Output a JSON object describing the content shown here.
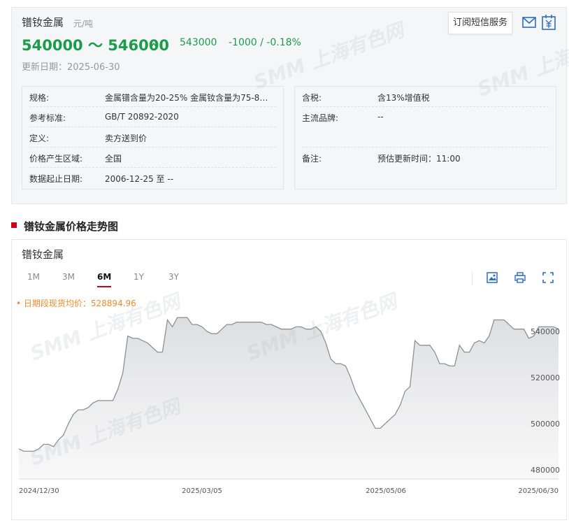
{
  "header": {
    "title": "镨钕金属",
    "unit": "元/吨",
    "price_range": "540000 ～ 546000",
    "avg_price": "543000",
    "change": "-1000  /  -0.18%",
    "updated": "更新日期：2025-06-30",
    "subscribe_label": "订阅短信服务",
    "trend_icon": "down-wave-icon"
  },
  "specs_left": [
    {
      "k": "规格:",
      "v": "金属镨含量为20-25% 金属钕含量为75-80..."
    },
    {
      "k": "参考标准:",
      "v": "GB/T 20892-2020"
    },
    {
      "k": "定义:",
      "v": "卖方送到价"
    },
    {
      "k": "价格产生区域:",
      "v": "全国"
    },
    {
      "k": "数据起止日期:",
      "v": "2006-12-25 至 --"
    }
  ],
  "specs_right": [
    {
      "k": "含税:",
      "v": "含13%增值税"
    },
    {
      "k": "主流品牌:",
      "v": "--"
    },
    {
      "k": "备注:",
      "v": "预估更新时间：11:00"
    }
  ],
  "section": {
    "title": "镨钕金属价格走势图"
  },
  "chart_panel": {
    "title": "镨钕金属",
    "tabs": [
      "1M",
      "3M",
      "6M",
      "1Y",
      "3Y"
    ],
    "active_tab": "6M",
    "avg_line": "• 日期段现货均价：528894.96"
  },
  "watermarks": [
    "SMM 上海有色网",
    "SMM 上海有色网",
    "SMM 上海有色网",
    "SMM 上海有色网",
    "SMM 上海有色网"
  ],
  "colors": {
    "green": "#1a9c4a",
    "red": "#d0021b",
    "orange": "#f08c2e"
  },
  "chart_data": {
    "type": "area",
    "x_tick_labels": [
      "2024/12/30",
      "2025/03/05",
      "2025/05/06",
      "2025/06/30"
    ],
    "y_tick_labels": [
      "480000",
      "500000",
      "520000",
      "540000"
    ],
    "ylim": [
      476000,
      550000
    ],
    "series": [
      {
        "values": [
          489000,
          488000,
          488000,
          488000,
          489000,
          491000,
          491000,
          490000,
          493000,
          495000,
          500000,
          504000,
          506000,
          506000,
          507000,
          509000,
          510000,
          510000,
          510000,
          510000,
          515000,
          522000,
          538000,
          537000,
          537000,
          536000,
          535000,
          533000,
          531000,
          531000,
          545000,
          542000,
          546000,
          546000,
          546000,
          543000,
          543000,
          542000,
          540000,
          539000,
          539000,
          541000,
          543000,
          543000,
          544000,
          544000,
          544000,
          544000,
          544000,
          544000,
          543000,
          543000,
          542000,
          541000,
          541000,
          541000,
          542000,
          542000,
          541000,
          541000,
          542000,
          540000,
          535000,
          528000,
          526000,
          526000,
          525000,
          520000,
          514000,
          510000,
          506000,
          502000,
          498000,
          498000,
          500000,
          502000,
          504000,
          508000,
          514000,
          516000,
          536000,
          534000,
          534000,
          534000,
          531000,
          526000,
          526000,
          525000,
          525000,
          534000,
          531000,
          531000,
          535000,
          536000,
          535000,
          538000,
          545000,
          545000,
          545000,
          543000,
          541000,
          541000,
          541000,
          537000,
          538000,
          542000,
          542000,
          542000,
          542000,
          541000
        ]
      }
    ],
    "grid": false
  }
}
